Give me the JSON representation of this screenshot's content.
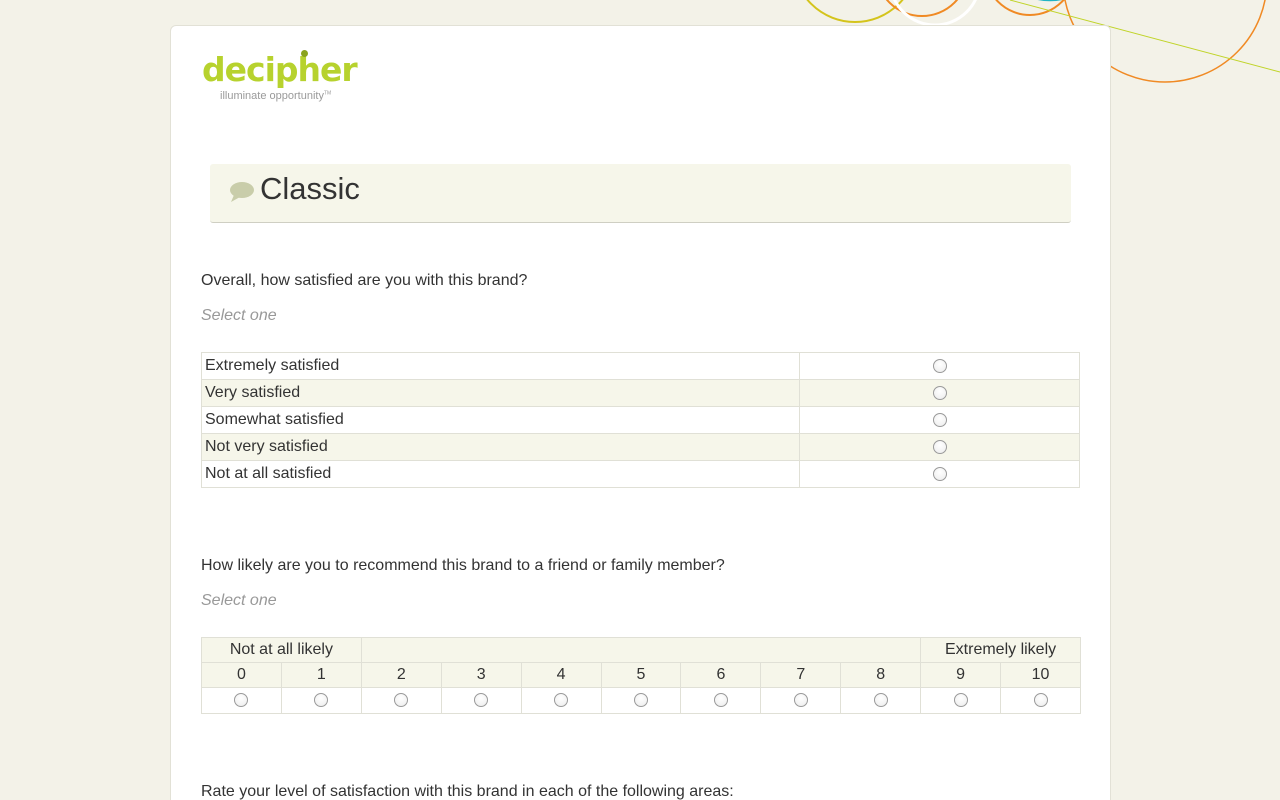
{
  "branding": {
    "logo_text": "decipher",
    "tagline": "illuminate opportunity",
    "tagline_mark": "TM",
    "accent": "#b7d22e"
  },
  "page": {
    "title": "Classic",
    "title_icon": "speech-bubble-icon"
  },
  "q1": {
    "text": "Overall, how satisfied are you with this brand?",
    "instruction": "Select one",
    "options": [
      {
        "label": "Extremely satisfied",
        "selected": false
      },
      {
        "label": "Very satisfied",
        "selected": false
      },
      {
        "label": "Somewhat satisfied",
        "selected": false
      },
      {
        "label": "Not very satisfied",
        "selected": false
      },
      {
        "label": "Not at all satisfied",
        "selected": false
      }
    ]
  },
  "q2": {
    "text": "How likely are you to recommend this brand to a friend or family member?",
    "instruction": "Select one",
    "low_anchor": "Not at all likely",
    "high_anchor": "Extremely likely",
    "scale": [
      "0",
      "1",
      "2",
      "3",
      "4",
      "5",
      "6",
      "7",
      "8",
      "9",
      "10"
    ]
  },
  "q3": {
    "text": "Rate your level of satisfaction with this brand in each of the following areas:"
  },
  "colors": {
    "background": "#f3f2e8",
    "row_shade": "#f6f6ea",
    "decor_orange": "#f08a24",
    "decor_yellow": "#d4c41c",
    "decor_teal": "#21b4c4",
    "decor_green": "#c0d428"
  }
}
